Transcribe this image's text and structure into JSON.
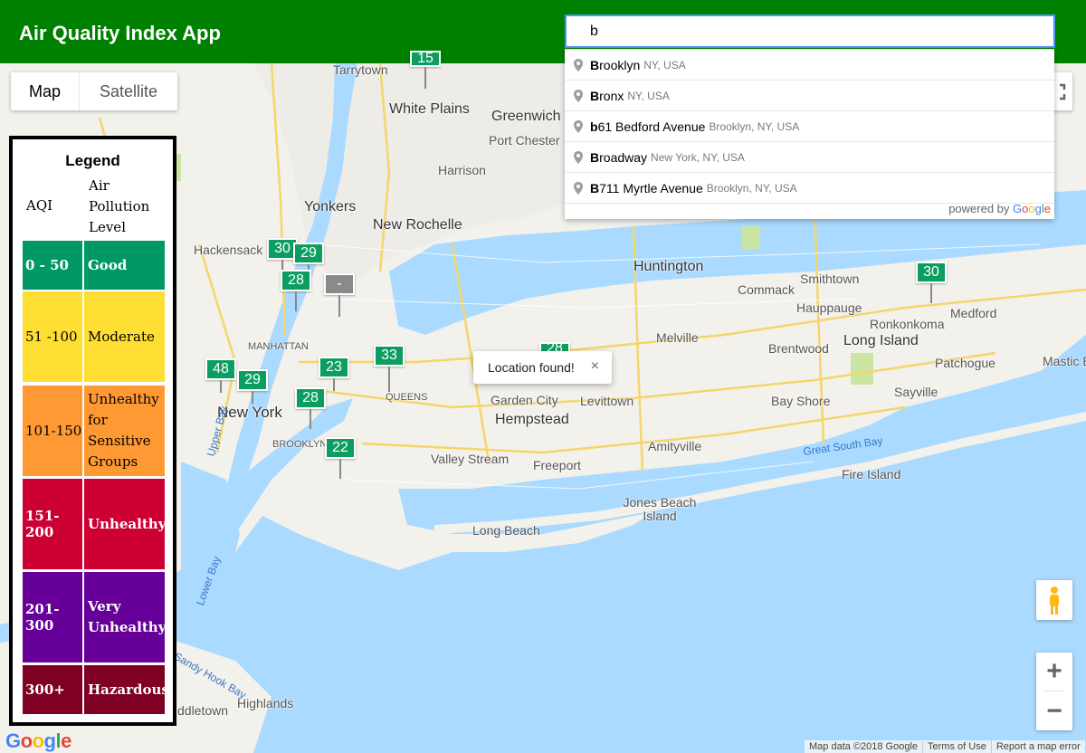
{
  "app": {
    "title": "Air Quality Index App"
  },
  "search": {
    "value": "b",
    "placeholder": ""
  },
  "map_type": {
    "map_label": "Map",
    "satellite_label": "Satellite",
    "selected": "Map"
  },
  "legend": {
    "title": "Legend",
    "aqi_header": "AQI",
    "level_header": "Air Pollution Level",
    "rows": [
      {
        "range": "0 - 50",
        "level": "Good",
        "color": "#009966",
        "text_color": "#ffffff",
        "bold": true
      },
      {
        "range": "51 -100",
        "level": "Moderate",
        "color": "#ffde33",
        "text_color": "#000000",
        "bold": false
      },
      {
        "range": "101-150",
        "level": "Unhealthy for Sensitive Groups",
        "color": "#ff9933",
        "text_color": "#000000",
        "bold": false
      },
      {
        "range": "151-200",
        "level": "Unhealthy",
        "color": "#cc0033",
        "text_color": "#ffffff",
        "bold": true
      },
      {
        "range": "201-300",
        "level": "Very Unhealthy",
        "color": "#660099",
        "text_color": "#ffffff",
        "bold": true
      },
      {
        "range": "300+",
        "level": "Hazardous",
        "color": "#7e0023",
        "text_color": "#ffffff",
        "bold": true
      }
    ]
  },
  "autocomplete": {
    "items": [
      {
        "match": "B",
        "rest": "rooklyn",
        "secondary": "NY, USA"
      },
      {
        "match": "B",
        "rest": "ronx",
        "secondary": "NY, USA"
      },
      {
        "match": "b",
        "rest": "61 Bedford Avenue",
        "secondary": "Brooklyn, NY, USA"
      },
      {
        "match": "B",
        "rest": "roadway",
        "secondary": "New York, NY, USA"
      },
      {
        "match": "B",
        "rest": "711 Myrtle Avenue",
        "secondary": "Brooklyn, NY, USA"
      }
    ],
    "powered_by": "powered by",
    "google_letters": [
      "G",
      "o",
      "o",
      "g",
      "l",
      "e"
    ]
  },
  "info_window": {
    "text": "Location found!",
    "close": "×"
  },
  "markers": [
    {
      "value": "15",
      "grey": false
    },
    {
      "value": "30",
      "grey": false
    },
    {
      "value": "29",
      "grey": false
    },
    {
      "value": "28",
      "grey": false
    },
    {
      "value": "-",
      "grey": true
    },
    {
      "value": "48",
      "grey": false
    },
    {
      "value": "29",
      "grey": false
    },
    {
      "value": "28",
      "grey": false
    },
    {
      "value": "23",
      "grey": false
    },
    {
      "value": "33",
      "grey": false
    },
    {
      "value": "22",
      "grey": false
    },
    {
      "value": "28",
      "grey": false
    },
    {
      "value": "30",
      "grey": false
    }
  ],
  "places": [
    "Tarrytown",
    "White Plains",
    "Greenwich",
    "Port Chester",
    "Harrison",
    "Yonkers",
    "New Rochelle",
    "Hackensack",
    "Huntington",
    "Smithtown",
    "Commack",
    "Hauppauge",
    "Ronkonkoma",
    "Medford",
    "Melville",
    "Brentwood",
    "Long Island",
    "Patchogue",
    "Mastic B",
    "Sayville",
    "Bay Shore",
    "MANHATTAN",
    "QUEENS",
    "New York",
    "BROOKLYN",
    "Garden City",
    "Levittown",
    "Hempstead",
    "Valley Stream",
    "Freeport",
    "Amityville",
    "Jones Beach Island",
    "Long Beach",
    "Fire Island",
    "Highlands",
    "ddletown"
  ],
  "water_labels": [
    "Great South Bay",
    "Upper Bay",
    "Lower Bay",
    "Sandy Hook Bay"
  ],
  "controls": {
    "zoom_in": "+",
    "zoom_out": "−"
  },
  "google_logo": "Google",
  "footer": {
    "map_data": "Map data ©2018 Google",
    "terms": "Terms of Use",
    "report": "Report a map error"
  }
}
